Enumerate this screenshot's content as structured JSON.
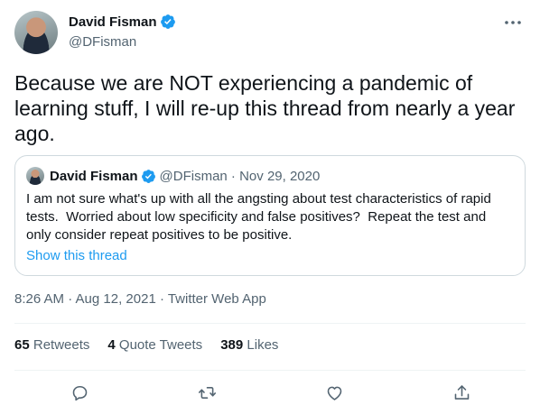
{
  "author": {
    "name": "David Fisman",
    "handle": "@DFisman"
  },
  "tweet": {
    "text": "Because we are NOT experiencing a pandemic of learning stuff, I will re-up this thread from nearly a year ago."
  },
  "quote": {
    "name": "David Fisman",
    "handle_date": "@DFisman · Nov 29, 2020",
    "text": "I am not sure what's up with all the angsting about test characteristics of rapid tests.  Worried about low specificity and false positives?  Repeat the test and only consider repeat positives to be positive.",
    "show_thread": "Show this thread"
  },
  "meta": {
    "timestamp": "8:26 AM · Aug 12, 2021 · Twitter Web App"
  },
  "stats": {
    "retweets_count": "65",
    "retweets_label": "Retweets",
    "quotes_count": "4",
    "quotes_label": "Quote Tweets",
    "likes_count": "389",
    "likes_label": "Likes"
  },
  "icons": {
    "more": "more-icon",
    "reply": "reply-icon",
    "retweet": "retweet-icon",
    "like": "like-icon",
    "share": "share-icon",
    "verified": "verified-badge-icon"
  },
  "colors": {
    "accent": "#1d9bf0",
    "secondary_text": "#536471",
    "border": "#cfd9de"
  }
}
